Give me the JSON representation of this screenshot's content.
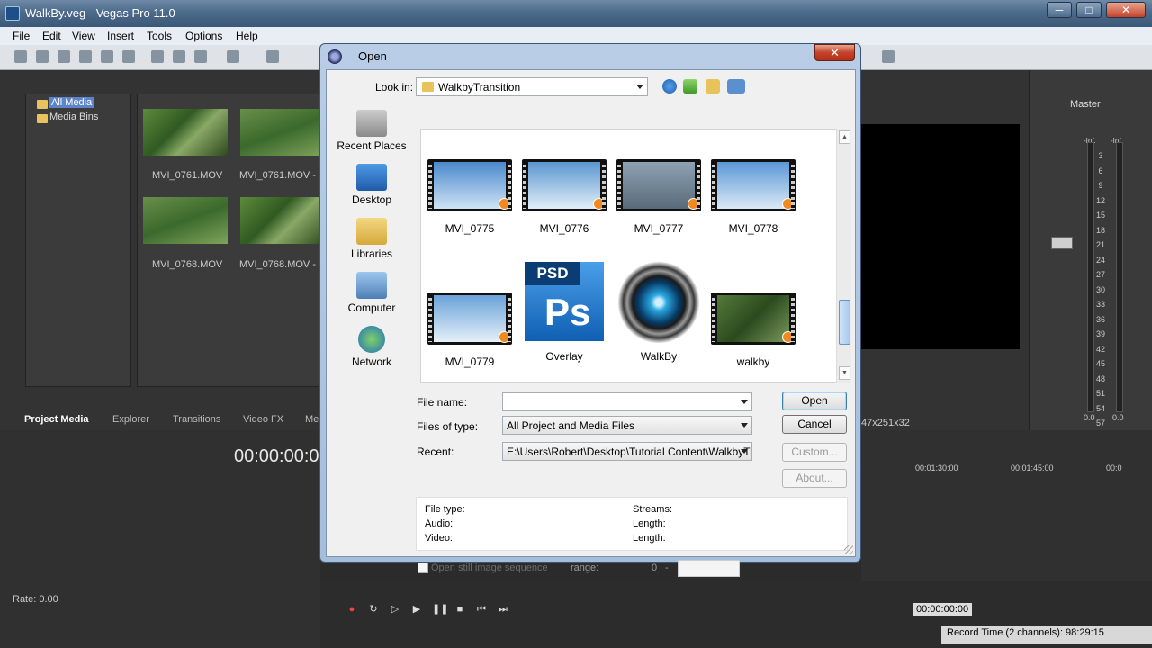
{
  "app": {
    "title": "WalkBy.veg - Vegas Pro 11.0",
    "window_controls": [
      "─",
      "□",
      "✕"
    ],
    "menu": [
      "File",
      "Edit",
      "View",
      "Insert",
      "Tools",
      "Options",
      "Help"
    ]
  },
  "media_tree": {
    "items": [
      {
        "label": "All Media",
        "selected": true
      },
      {
        "label": "Media Bins",
        "selected": false
      }
    ]
  },
  "media_thumbs": [
    {
      "label": "MVI_0761.MOV"
    },
    {
      "label": "MVI_0761.MOV - ..."
    },
    {
      "label": "MVI_0768.MOV"
    },
    {
      "label": "MVI_0768.MOV - ..."
    }
  ],
  "window_tabs": [
    "Project Media",
    "Explorer",
    "Transitions",
    "Video FX",
    "Me"
  ],
  "timeline": {
    "timecode": "00:00:00:0",
    "rate": "Rate: 0.00",
    "ruler": [
      "00:01:30:00",
      "00:01:45:00",
      "00:0"
    ],
    "cursor_time": "00:00:00:00",
    "record_time": "Record Time (2 channels): 98:29:15"
  },
  "preview": {
    "info": "47x251x32"
  },
  "mixer": {
    "label": "Master",
    "peak_left": "-Inf.",
    "peak_right": "-Inf.",
    "ticks": [
      "3",
      "6",
      "9",
      "12",
      "15",
      "18",
      "21",
      "24",
      "27",
      "30",
      "33",
      "36",
      "39",
      "42",
      "45",
      "48",
      "51",
      "54",
      "57"
    ],
    "val_left": "0.0",
    "val_right": "0.0"
  },
  "dialog": {
    "title": "Open",
    "close_glyph": "✕",
    "look_in_label": "Look in:",
    "look_in_value": "WalkbyTransition",
    "places": [
      "Recent Places",
      "Desktop",
      "Libraries",
      "Computer",
      "Network"
    ],
    "files": [
      {
        "name": "MVI_0775",
        "kind": "video",
        "sky": "#6fa3d8"
      },
      {
        "name": "MVI_0776",
        "kind": "video",
        "sky": "#7fb0dc"
      },
      {
        "name": "MVI_0777",
        "kind": "video",
        "sky": "#8a9cae"
      },
      {
        "name": "MVI_0778",
        "kind": "video",
        "sky": "#7fb2e0"
      },
      {
        "name": "MVI_0779",
        "kind": "video",
        "sky": "#86b6e2"
      },
      {
        "name": "Overlay",
        "kind": "psd"
      },
      {
        "name": "WalkBy",
        "kind": "veg"
      },
      {
        "name": "walkby",
        "kind": "video",
        "sky": "#5f7f4a"
      }
    ],
    "psd_tag": "PSD",
    "psd_mark": "Ps",
    "file_name_label": "File name:",
    "file_name_value": "",
    "files_of_type_label": "Files of type:",
    "files_of_type_value": "All Project and Media Files",
    "recent_label": "Recent:",
    "recent_value": "E:\\Users\\Robert\\Desktop\\Tutorial Content\\WalkbyTra",
    "buttons": {
      "open": "Open",
      "cancel": "Cancel",
      "custom": "Custom...",
      "about": "About..."
    },
    "info": {
      "file_type": "File type:",
      "audio": "Audio:",
      "video": "Video:",
      "streams": "Streams:",
      "length1": "Length:",
      "length2": "Length:"
    },
    "sequence_label": "Open still image sequence",
    "range_label": "range:",
    "range_start": "0",
    "range_dash": "-",
    "scroll_up": "▲",
    "scroll_down": "▼"
  },
  "colors": {
    "title_gradient": "#4c6a8b",
    "dialog_frame": "#b9cde6",
    "selection": "#5d84c8",
    "play_badge": "#f08a1e"
  }
}
